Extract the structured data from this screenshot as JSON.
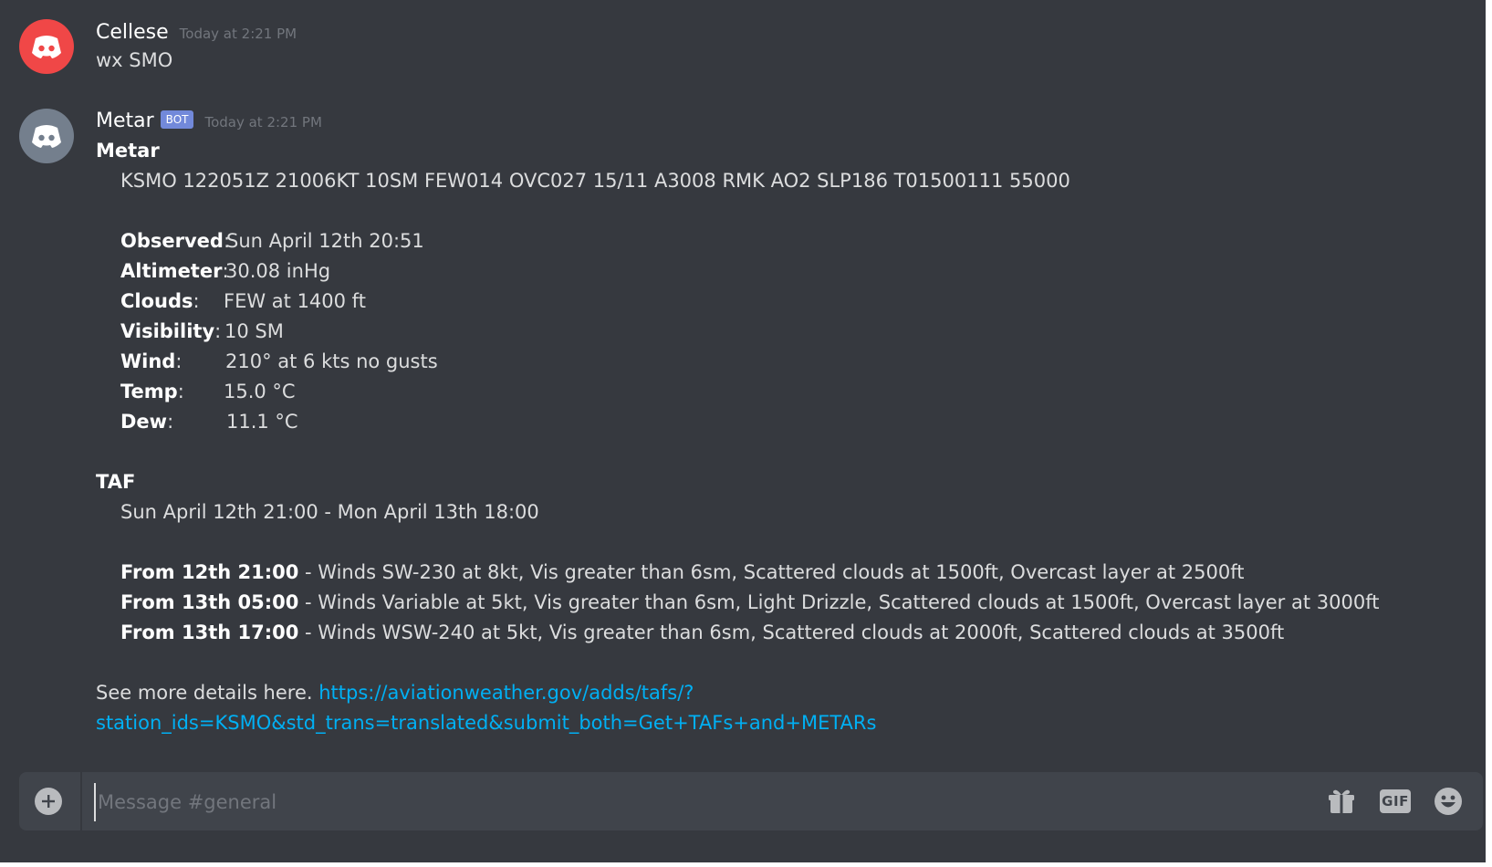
{
  "colors": {
    "background": "#36393f",
    "text": "#dcddde",
    "username": "#ffffff",
    "timestamp": "#72767d",
    "link": "#00b0f4",
    "bot_tag": "#7289da",
    "avatar_red": "#f04747",
    "avatar_gray": "#747f8d",
    "composer_bg": "#40444b"
  },
  "messages": [
    {
      "author": "Cellese",
      "timestamp": "Today at 2:21 PM",
      "avatar_icon": "discord-logo-icon",
      "text": "wx SMO"
    },
    {
      "author": "Metar",
      "bot_tag": "BOT",
      "timestamp": "Today at 2:21 PM",
      "avatar_icon": "discord-logo-icon",
      "metar_heading": "Metar",
      "raw_metar": "KSMO 122051Z 21006KT 10SM FEW014 OVC027 15/11 A3008 RMK AO2 SLP186 T01500111 55000",
      "fields": [
        {
          "label": "Observed",
          "sep": ":",
          "value": "Sun April 12th 20:51"
        },
        {
          "label": "Altimeter",
          "sep": ":",
          "value": "30.08 inHg"
        },
        {
          "label": "Clouds",
          "sep": ":",
          "value": "FEW at 1400 ft"
        },
        {
          "label": "Visibility",
          "sep": ":",
          "value": "10 SM"
        },
        {
          "label": "Wind",
          "sep": ":",
          "value": "210° at 6 kts no gusts"
        },
        {
          "label": "Temp",
          "sep": ":",
          "value": "15.0 °C"
        },
        {
          "label": "Dew",
          "sep": ":",
          "value": "11.1 °C"
        }
      ],
      "taf_heading": "TAF",
      "taf_period": "Sun April 12th 21:00 - Mon April 13th 18:00",
      "forecasts": [
        {
          "from": "From 12th 21:00",
          "text": " - Winds SW-230 at 8kt, Vis greater than 6sm, Scattered clouds at 1500ft, Overcast layer at 2500ft"
        },
        {
          "from": "From 13th 05:00",
          "text": " - Winds Variable at 5kt, Vis greater than 6sm, Light Drizzle, Scattered clouds at 1500ft, Overcast layer at 3000ft"
        },
        {
          "from": "From 13th 17:00",
          "text": " - Winds WSW-240 at 5kt, Vis greater than 6sm, Scattered clouds at 2000ft, Scattered clouds at 3500ft"
        }
      ],
      "details_prefix": "See more details here. ",
      "details_link_line1": "https://aviationweather.gov/adds/tafs/?",
      "details_link_line2": "station_ids=KSMO&std_trans=translated&submit_both=Get+TAFs+and+METARs"
    }
  ],
  "composer": {
    "placeholder": "Message #general",
    "plus_icon": "plus-circle-icon",
    "gift_icon": "gift-icon",
    "gif_label": "GIF",
    "emoji_icon": "emoji-icon"
  }
}
